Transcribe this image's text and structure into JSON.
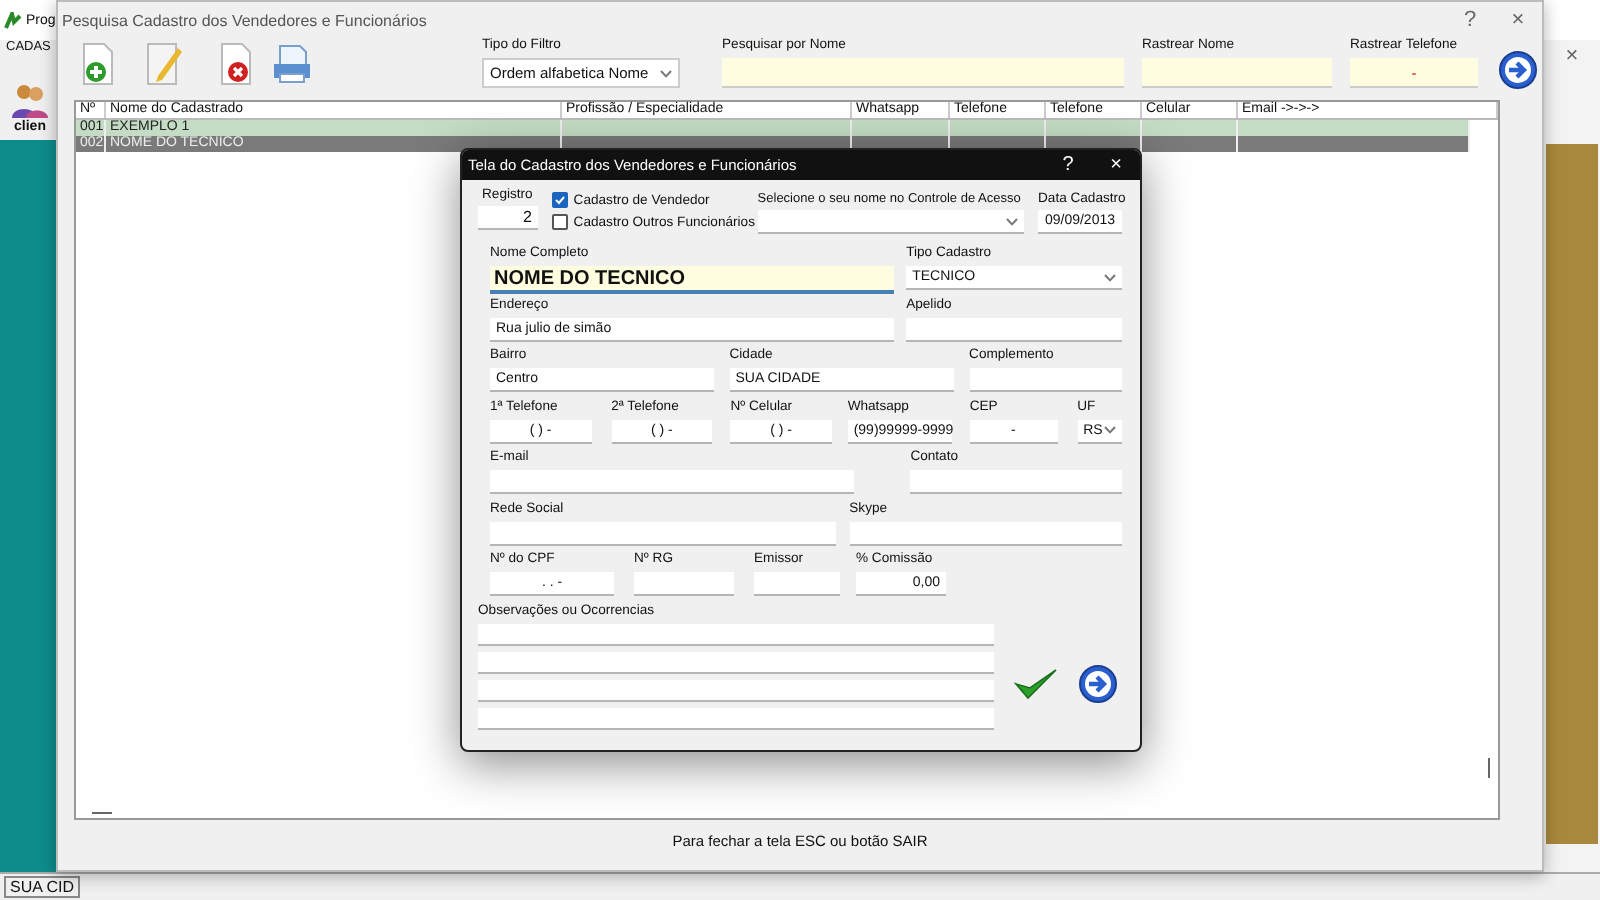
{
  "background_app": {
    "title": "Prog",
    "menu": "CADAS",
    "shortcut": "clien",
    "status": "SUA CID"
  },
  "search_window": {
    "title": "Pesquisa Cadastro dos Vendedores e Funcionários",
    "help": "?",
    "close": "×",
    "filter": {
      "label": "Tipo do Filtro",
      "value": "Ordem alfabetica Nome"
    },
    "search_name": {
      "label": "Pesquisar por Nome"
    },
    "track_name": {
      "label": "Rastrear Nome"
    },
    "track_phone": {
      "label": "Rastrear Telefone",
      "value": "-"
    },
    "table": {
      "columns": [
        "Nº",
        "Nome do Cadastrado",
        "Profissão / Especialidade",
        "Whatsapp",
        "Telefone",
        "Telefone",
        "Celular",
        "Email ->->->"
      ],
      "rows": [
        {
          "cells": [
            "001",
            "EXEMPLO 1",
            "",
            "",
            "",
            "",
            "",
            ""
          ],
          "selected": false
        },
        {
          "cells": [
            "002",
            "NOME DO TECNICO",
            "",
            "",
            "",
            "",
            "",
            ""
          ],
          "selected": true
        }
      ]
    },
    "footer": "Para fechar a tela ESC ou botão SAIR"
  },
  "outer_close": "×",
  "dialog": {
    "title": "Tela do Cadastro dos Vendedores e Funcionários",
    "help": "?",
    "close": "×",
    "registro": {
      "label": "Registro",
      "value": "2"
    },
    "checkboxes": [
      {
        "label": "Cadastro de Vendedor",
        "checked": true
      },
      {
        "label": "Cadastro Outros Funcionários",
        "checked": false
      }
    ],
    "access": {
      "label": "Selecione o seu nome no Controle de Acesso"
    },
    "date": {
      "label": "Data Cadastro",
      "value": "09/09/2013"
    },
    "form_lines": [
      [
        {
          "label": "Nome Completo",
          "value": "NOME DO TECNICO",
          "kind": "name"
        },
        {
          "label": "Tipo Cadastro",
          "value": "TECNICO",
          "kind": "select"
        }
      ],
      [
        {
          "label": "Endereço",
          "value": "Rua julio de simão",
          "kind": "text"
        },
        {
          "label": "Apelido",
          "kind": "text"
        }
      ],
      [
        {
          "label": "Bairro",
          "value": "Centro",
          "kind": "text"
        },
        {
          "label": "Cidade",
          "value": "SUA CIDADE",
          "kind": "text"
        },
        {
          "label": "Complemento",
          "kind": "text"
        }
      ],
      [
        {
          "label": "1ª Telefone",
          "value": "(  )   -",
          "kind": "mask"
        },
        {
          "label": "2ª Telefone",
          "value": "(  )   -",
          "kind": "mask"
        },
        {
          "label": "Nº Celular",
          "value": "(  )   -",
          "kind": "mask"
        },
        {
          "label": "Whatsapp",
          "value": "(99)99999-9999",
          "kind": "text"
        },
        {
          "label": "CEP",
          "value": "-",
          "kind": "mask"
        },
        {
          "label": "UF",
          "value": "RS",
          "kind": "select"
        }
      ],
      [
        {
          "label": "E-mail",
          "kind": "text"
        },
        {
          "label": "Contato",
          "kind": "text"
        }
      ],
      [
        {
          "label": "Rede Social",
          "kind": "text"
        },
        {
          "label": "Skype",
          "kind": "text"
        }
      ],
      [
        {
          "label": "Nº do CPF",
          "value": ".   .   -",
          "kind": "mask"
        },
        {
          "label": "Nº RG",
          "kind": "text"
        },
        {
          "label": "Emissor",
          "kind": "text"
        },
        {
          "label": "% Comissão",
          "value": "0,00",
          "kind": "number"
        }
      ]
    ],
    "notes": {
      "label": "Observações ou Ocorrencias"
    }
  }
}
